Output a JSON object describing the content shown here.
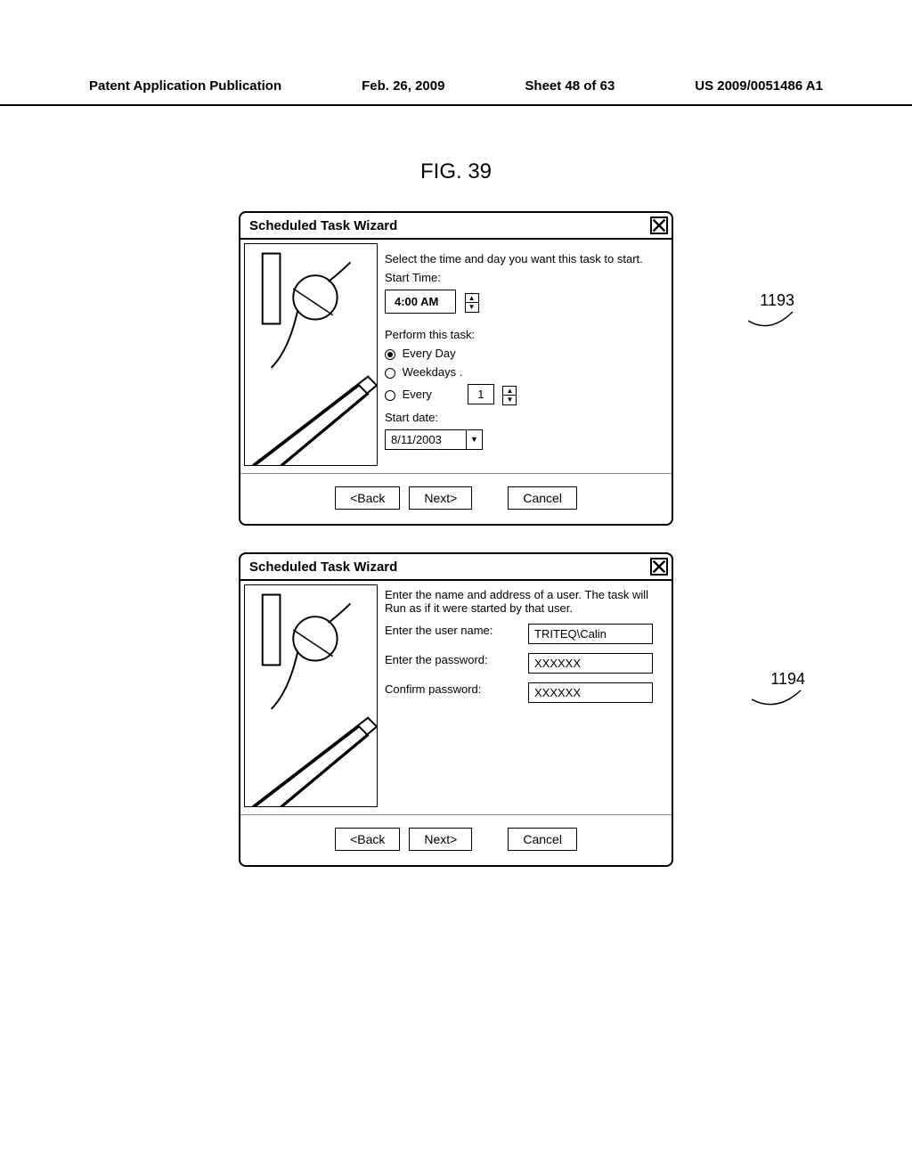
{
  "header": {
    "pub": "Patent Application Publication",
    "date": "Feb. 26, 2009",
    "sheet": "Sheet 48 of 63",
    "pubno": "US 2009/0051486 A1"
  },
  "figure_label": "FIG. 39",
  "dialog1": {
    "title": "Scheduled Task Wizard",
    "instruction": "Select the time and day you want this task to start.",
    "start_time_label": "Start Time:",
    "start_time_value": "4:00 AM",
    "perform_label": "Perform this task:",
    "opt_everyday": "Every Day",
    "opt_weekdays": "Weekdays .",
    "opt_every": "Every",
    "every_value": "1",
    "start_date_label": "Start date:",
    "start_date_value": "8/11/2003",
    "back": "<Back",
    "next": "Next>",
    "cancel": "Cancel",
    "callout": "1193"
  },
  "dialog2": {
    "title": "Scheduled Task Wizard",
    "instruction1": "Enter the name and address of a user. The task will",
    "instruction2": "Run as if it were started by that user.",
    "user_label": "Enter the user name:",
    "user_value": "TRITEQ\\Calin",
    "pass_label": "Enter the password:",
    "pass_value": "XXXXXX",
    "confirm_label": "Confirm password:",
    "confirm_value": "XXXXXX",
    "back": "<Back",
    "next": "Next>",
    "cancel": "Cancel",
    "callout": "1194"
  }
}
